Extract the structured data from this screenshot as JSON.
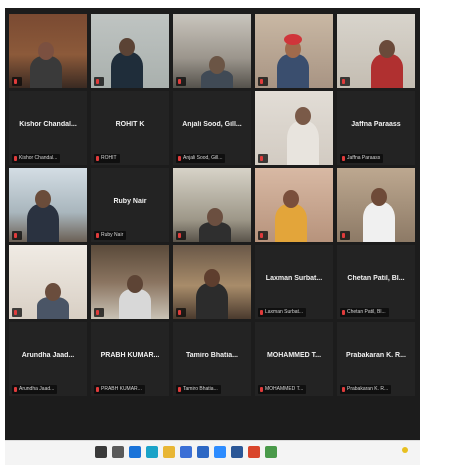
{
  "participants": [
    {
      "tag": "",
      "center": "",
      "video": true,
      "scene": "bookshelf",
      "active": true
    },
    {
      "tag": "",
      "center": "",
      "video": true,
      "scene": "man-white"
    },
    {
      "tag": "",
      "center": "",
      "video": true,
      "scene": "room-shelf"
    },
    {
      "tag": "",
      "center": "",
      "video": true,
      "scene": "turban"
    },
    {
      "tag": "",
      "center": "",
      "video": true,
      "scene": "man-ac"
    },
    {
      "tag": "Kishor Chandal...",
      "center": "Kishor Chandal...",
      "video": false
    },
    {
      "tag": "ROHIT",
      "center": "ROHIT K",
      "video": false
    },
    {
      "tag": "Anjali Sood, Gill...",
      "center": "Anjali Sood, Gill...",
      "video": false
    },
    {
      "tag": "",
      "center": "",
      "video": true,
      "scene": "man-wall"
    },
    {
      "tag": "Jaffna Paraass",
      "center": "Jaffna Paraass",
      "video": false
    },
    {
      "tag": "",
      "center": "",
      "video": true,
      "scene": "man-window"
    },
    {
      "tag": "Ruby Nair",
      "center": "Ruby Nair",
      "video": false
    },
    {
      "tag": "",
      "center": "",
      "video": true,
      "scene": "man-cabinet"
    },
    {
      "tag": "",
      "center": "",
      "video": true,
      "scene": "woman"
    },
    {
      "tag": "",
      "center": "",
      "video": true,
      "scene": "man-frame"
    },
    {
      "tag": "",
      "center": "",
      "video": true,
      "scene": "room-door"
    },
    {
      "tag": "",
      "center": "",
      "video": true,
      "scene": "office-desk"
    },
    {
      "tag": "",
      "center": "",
      "video": true,
      "scene": "man-library"
    },
    {
      "tag": "Laxman Surbat...",
      "center": "Laxman Surbat...",
      "video": false
    },
    {
      "tag": "Chetan Patil, Bl...",
      "center": "Chetan Patil, Bl...",
      "video": false
    },
    {
      "tag": "Arundha Jaad...",
      "center": "Arundha Jaad...",
      "video": false
    },
    {
      "tag": "PRABH KUMAR...",
      "center": "PRABH KUMAR...",
      "video": false
    },
    {
      "tag": "Tamiro Bhatia...",
      "center": "Tamiro Bhatia...",
      "video": false
    },
    {
      "tag": "MOHAMMED T...",
      "center": "MOHAMMED T...",
      "video": false
    },
    {
      "tag": "Prabakaran K. R...",
      "center": "Prabakaran K. R...",
      "video": false
    }
  ],
  "taskbar": {
    "search_label": "",
    "apps": [
      {
        "name": "search-icon",
        "color": "#3a3a3a"
      },
      {
        "name": "task-view-icon",
        "color": "#5a5a5a"
      },
      {
        "name": "windows-icon",
        "color": "#1a73d9"
      },
      {
        "name": "edge-icon",
        "color": "#1aa3c8"
      },
      {
        "name": "folder-icon",
        "color": "#e8b634"
      },
      {
        "name": "store-icon",
        "color": "#3b6fd6"
      },
      {
        "name": "mail-icon",
        "color": "#2d67c4"
      },
      {
        "name": "zoom-icon",
        "color": "#2d8cff"
      },
      {
        "name": "word-icon",
        "color": "#2b5797"
      },
      {
        "name": "chrome-icon",
        "color": "#d9452b"
      },
      {
        "name": "app-icon",
        "color": "#4a9a4a"
      }
    ],
    "tray_temp": "",
    "tray_time": ""
  },
  "colors": {
    "background": "#1c1c1c",
    "tile": "#232323",
    "active_border": "#b8e04a"
  }
}
